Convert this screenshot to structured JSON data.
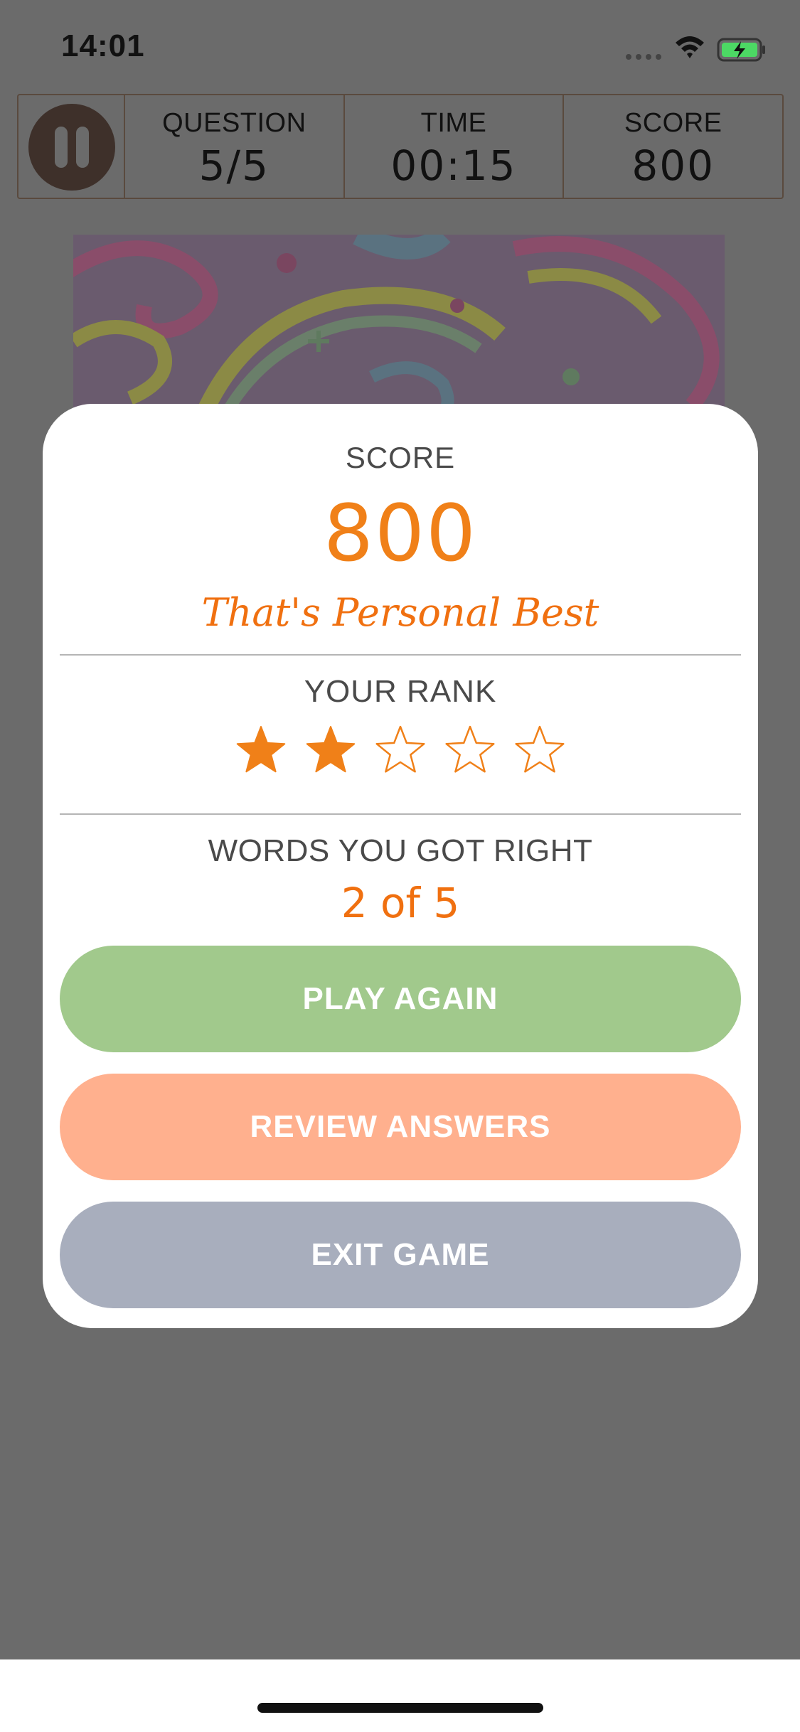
{
  "status_bar": {
    "time": "14:01"
  },
  "hud": {
    "question_label": "QUESTION",
    "question_value": "5/5",
    "time_label": "TIME",
    "time_value": "00:15",
    "score_label": "SCORE",
    "score_value": "800"
  },
  "modal": {
    "score_label": "SCORE",
    "score_value": "800",
    "best_text": "That's Personal Best",
    "rank_label": "YOUR RANK",
    "rank_stars_filled": 2,
    "rank_stars_total": 5,
    "words_label": "WORDS YOU GOT RIGHT",
    "words_value": "2 of 5",
    "buttons": {
      "play_again": "PLAY AGAIN",
      "review_answers": "REVIEW ANSWERS",
      "exit_game": "EXIT GAME"
    }
  },
  "icons": {
    "pause": "pause-icon",
    "star_filled": "star-filled-icon",
    "star_empty": "star-outline-icon",
    "wifi": "wifi-icon",
    "battery": "battery-charging-icon"
  },
  "colors": {
    "accent_orange": "#f08018",
    "play_green": "#a1c98c",
    "review_salmon": "#ffb08e",
    "exit_gray": "#a8aebd",
    "overlay": "#6b6b6b"
  }
}
